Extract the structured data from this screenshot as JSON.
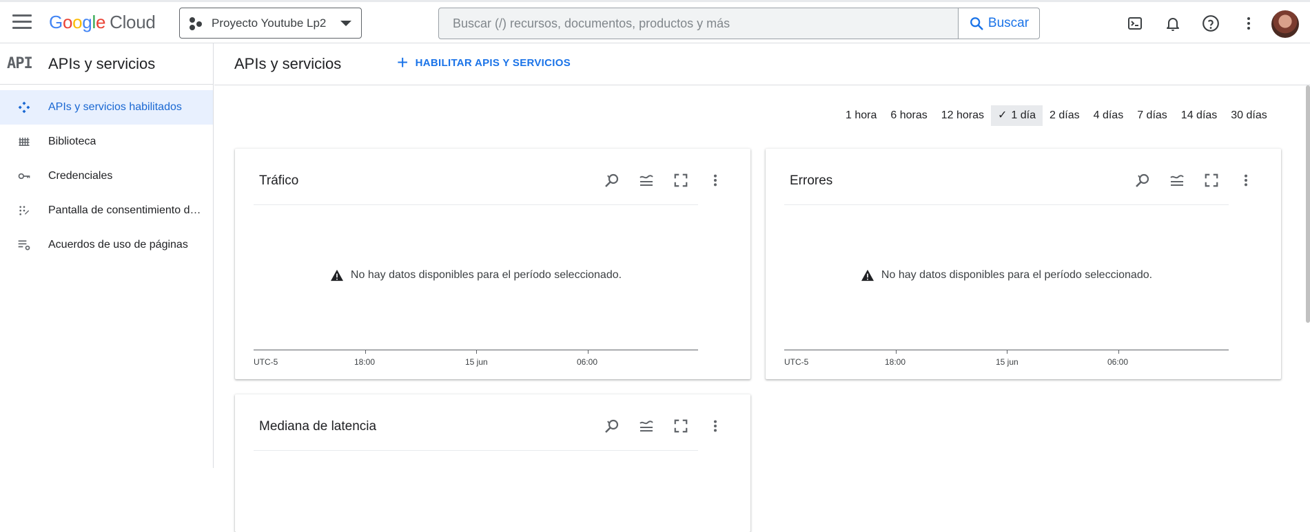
{
  "topbar": {
    "logo_parts": [
      "G",
      "o",
      "o",
      "g",
      "l",
      "e"
    ],
    "logo_cloud": "Cloud",
    "project_name": "Proyecto Youtube Lp2",
    "search_placeholder": "Buscar (/) recursos, documentos, productos y más",
    "search_button": "Buscar"
  },
  "sidebar": {
    "mark": "API",
    "title": "APIs y servicios",
    "items": [
      {
        "label": "APIs y servicios habilitados",
        "icon": "enabled-apis-icon",
        "active": true
      },
      {
        "label": "Biblioteca",
        "icon": "library-icon"
      },
      {
        "label": "Credenciales",
        "icon": "key-icon"
      },
      {
        "label": "Pantalla de consentimiento de OAuth",
        "icon": "consent-icon"
      },
      {
        "label": "Acuerdos de uso de páginas",
        "icon": "page-agreements-icon"
      }
    ]
  },
  "main": {
    "title": "APIs y servicios",
    "enable_button": "HABILITAR APIS Y SERVICIOS",
    "ranges": [
      "1 hora",
      "6 horas",
      "12 horas",
      "1 día",
      "2 días",
      "4 días",
      "7 días",
      "14 días",
      "30 días"
    ],
    "selected_range": "1 día",
    "cards": [
      {
        "title": "Tráfico"
      },
      {
        "title": "Errores"
      },
      {
        "title": "Mediana de latencia"
      }
    ],
    "no_data": "No hay datos disponibles para el período seleccionado.",
    "x_ticks": [
      "UTC-5",
      "18:00",
      "15 jun",
      "06:00"
    ]
  },
  "colors": {
    "accent": "#1a73e8",
    "active_bg": "#e8f0fe",
    "divider": "#dadce0"
  }
}
